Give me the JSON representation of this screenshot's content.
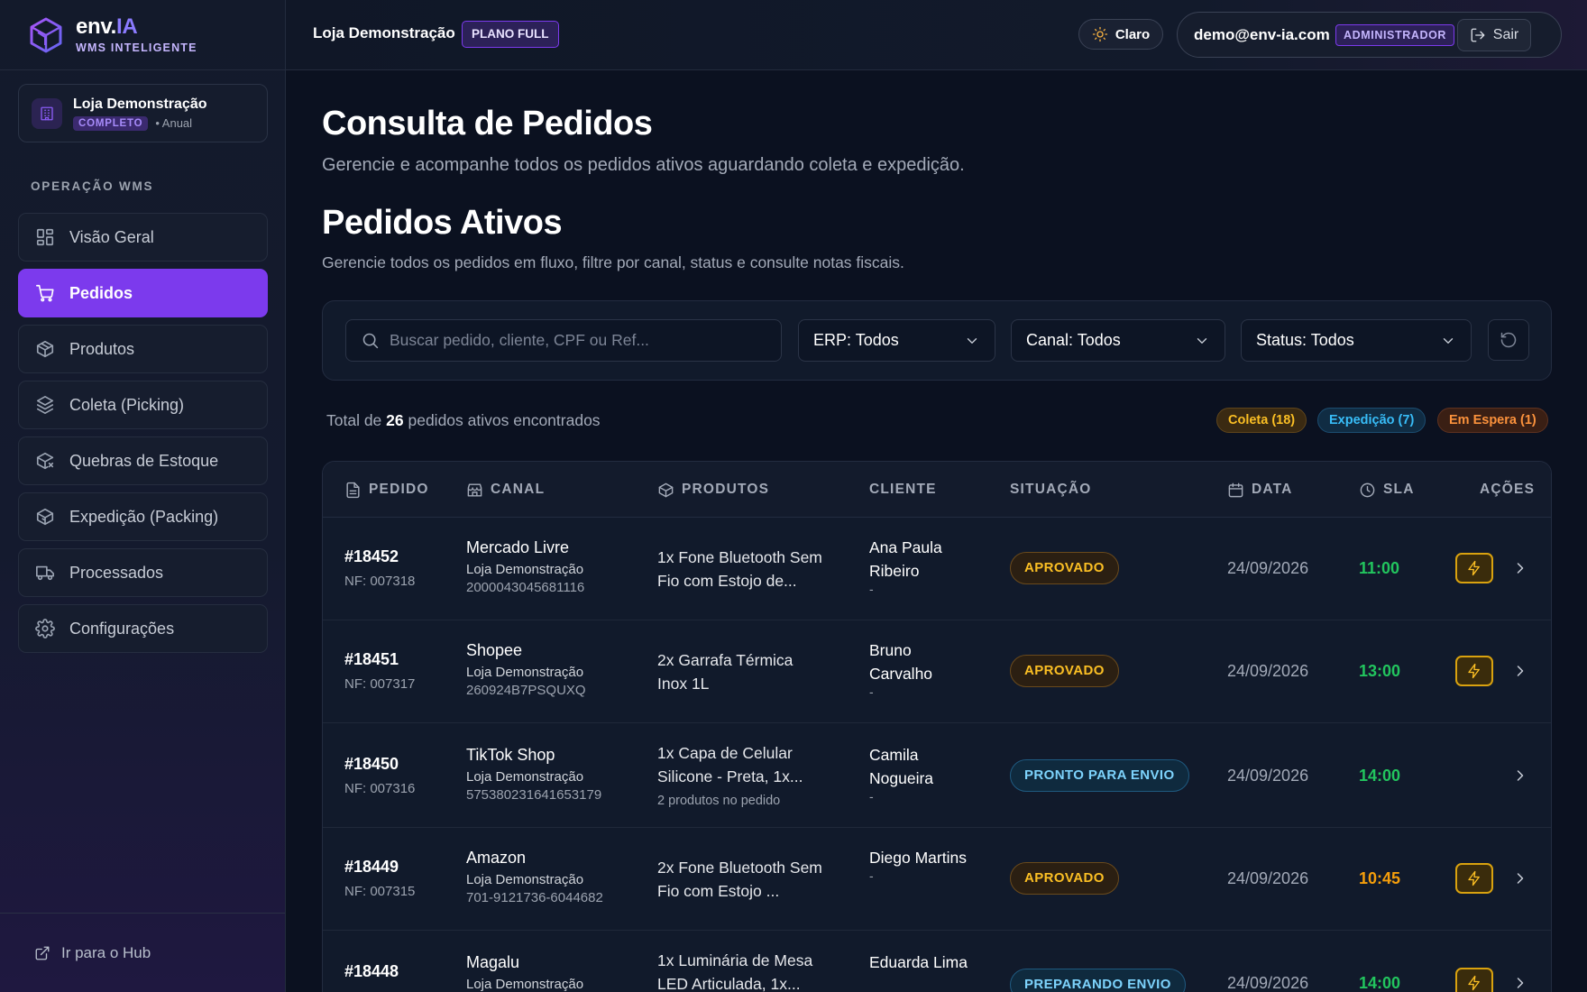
{
  "brand": {
    "name_main": "env.",
    "name_accent": "IA",
    "subtitle": "WMS INTELIGENTE"
  },
  "store_card": {
    "name": "Loja Demonstração",
    "plan_badge": "COMPLETO",
    "period": "• Anual"
  },
  "sidebar": {
    "section_label": "OPERAÇÃO WMS",
    "items": [
      {
        "label": "Visão Geral",
        "icon": "grid-icon"
      },
      {
        "label": "Pedidos",
        "icon": "cart-icon",
        "active": true
      },
      {
        "label": "Produtos",
        "icon": "box-icon"
      },
      {
        "label": "Coleta (Picking)",
        "icon": "boxes-icon"
      },
      {
        "label": "Quebras de Estoque",
        "icon": "box-broken-icon"
      },
      {
        "label": "Expedição (Packing)",
        "icon": "package-icon"
      },
      {
        "label": "Processados",
        "icon": "truck-icon"
      },
      {
        "label": "Configurações",
        "icon": "gear-icon"
      }
    ],
    "hub_link": "Ir para o Hub"
  },
  "header": {
    "store": "Loja Demonstração",
    "plan": "PLANO FULL",
    "theme_label": "Claro",
    "user_email": "demo@env-ia.com",
    "role": "ADMINISTRADOR",
    "logout_label": "Sair"
  },
  "page": {
    "title": "Consulta de Pedidos",
    "subtitle": "Gerencie e acompanhe todos os pedidos ativos aguardando coleta e expedição.",
    "section_title": "Pedidos Ativos",
    "section_subtitle": "Gerencie todos os pedidos em fluxo, filtre por canal, status e consulte notas fiscais."
  },
  "filters": {
    "search_placeholder": "Buscar pedido, cliente, CPF ou Ref...",
    "erp": "ERP: Todos",
    "canal": "Canal: Todos",
    "status": "Status: Todos"
  },
  "summary": {
    "prefix": "Total de ",
    "count": "26",
    "suffix": " pedidos ativos encontrados",
    "pills": {
      "coleta": "Coleta (18)",
      "expedicao": "Expedição (7)",
      "espera": "Em Espera (1)"
    }
  },
  "table": {
    "headers": {
      "pedido": "PEDIDO",
      "canal": "CANAL",
      "produtos": "PRODUTOS",
      "cliente": "CLIENTE",
      "situacao": "SITUAÇÃO",
      "data": "DATA",
      "sla": "SLA",
      "acoes": "AÇÕES"
    },
    "rows": [
      {
        "id": "#18452",
        "nf": "NF: 007318",
        "canal": "Mercado Livre",
        "loja": "Loja Demonstração",
        "ref": "2000043045681116",
        "produto": "1x Fone Bluetooth Sem Fio com Estojo de...",
        "extra": "",
        "cliente": "Ana Paula Ribeiro",
        "cliente_dash": "-",
        "status": "APROVADO",
        "data": "24/09/2026",
        "sla": "11:00",
        "sla_state": "ok",
        "acao_rapida": true
      },
      {
        "id": "#18451",
        "nf": "NF: 007317",
        "canal": "Shopee",
        "loja": "Loja Demonstração",
        "ref": "260924B7PSQUXQ",
        "produto": "2x Garrafa Térmica Inox 1L",
        "extra": "",
        "cliente": "Bruno Carvalho",
        "cliente_dash": "-",
        "status": "APROVADO",
        "data": "24/09/2026",
        "sla": "13:00",
        "sla_state": "ok",
        "acao_rapida": true
      },
      {
        "id": "#18450",
        "nf": "NF: 007316",
        "canal": "TikTok Shop",
        "loja": "Loja Demonstração",
        "ref": "575380231641653179",
        "produto": "1x Capa de Celular Silicone - Preta, 1x...",
        "extra": "2 produtos no pedido",
        "cliente": "Camila Nogueira",
        "cliente_dash": "-",
        "status": "PRONTO PARA ENVIO",
        "data": "24/09/2026",
        "sla": "14:00",
        "sla_state": "ok",
        "acao_rapida": false
      },
      {
        "id": "#18449",
        "nf": "NF: 007315",
        "canal": "Amazon",
        "loja": "Loja Demonstração",
        "ref": "701-9121736-6044682",
        "produto": "2x Fone Bluetooth Sem Fio com Estojo ...",
        "extra": "",
        "cliente": "Diego Martins",
        "cliente_dash": "-",
        "status": "APROVADO",
        "data": "24/09/2026",
        "sla": "10:45",
        "sla_state": "warn",
        "acao_rapida": true
      },
      {
        "id": "#18448",
        "nf": "",
        "canal": "Magalu",
        "loja": "Loja Demonstração",
        "ref": "",
        "produto": "1x Luminária de Mesa LED Articulada, 1x...",
        "extra": "",
        "cliente": "Eduarda Lima",
        "cliente_dash": "",
        "status": "PREPARANDO ENVIO",
        "data": "24/09/2026",
        "sla": "14:00",
        "sla_state": "ok",
        "acao_rapida": true
      }
    ]
  },
  "colors": {
    "accent": "#7c3aed",
    "background": "#0b1120",
    "sla_ok": "#22c55e",
    "sla_warn": "#f59e0b",
    "status_aprovado": "#fbbf24",
    "status_envio": "#7dd3fc"
  }
}
